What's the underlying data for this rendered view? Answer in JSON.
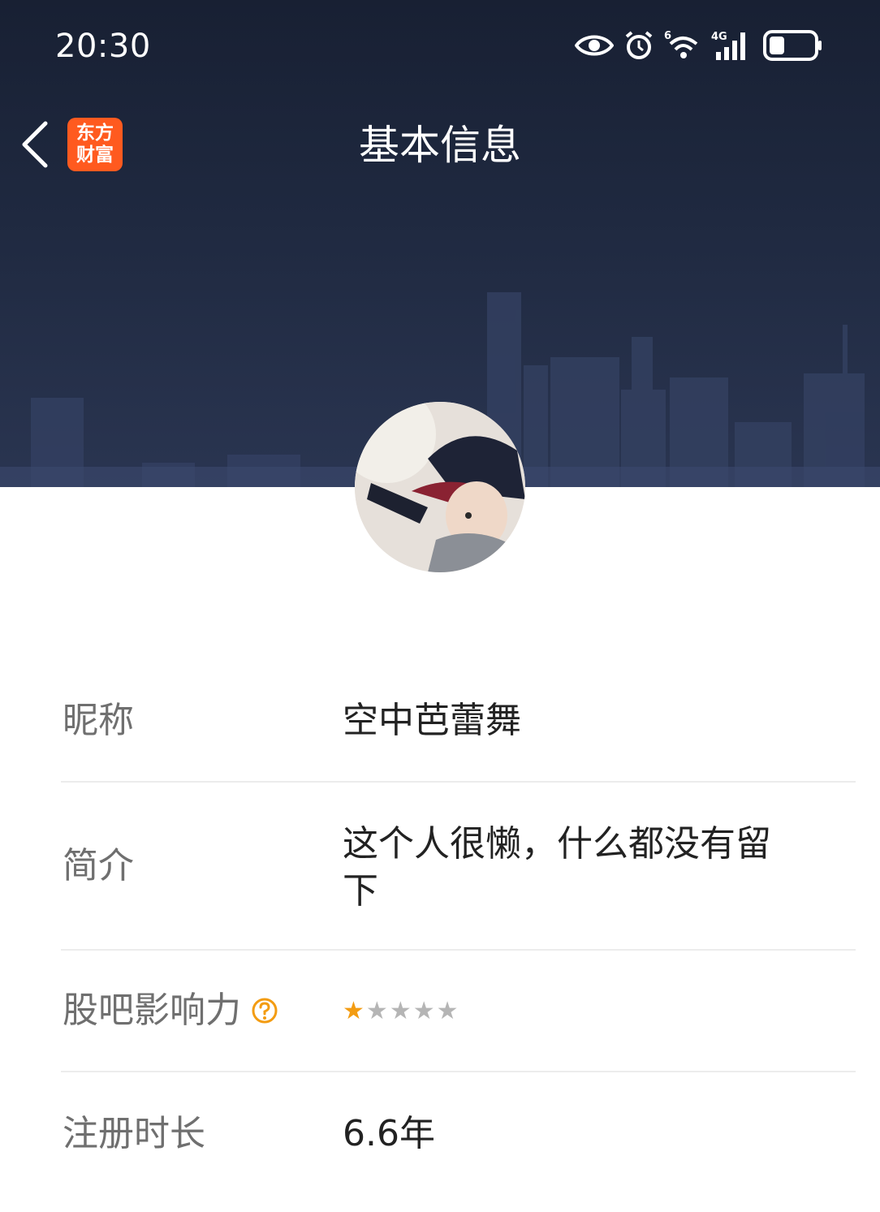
{
  "status_bar": {
    "time": "20:30",
    "icons": [
      "eye-icon",
      "alarm-icon",
      "wifi-icon",
      "cellular-signal-icon",
      "battery-icon"
    ],
    "wifi_badge": "6",
    "network_label": "4G"
  },
  "nav": {
    "back_icon": "chevron-left-icon",
    "app_logo_line1": "东方",
    "app_logo_line2": "财富",
    "title": "基本信息"
  },
  "profile": {
    "fields": [
      {
        "label": "昵称",
        "value": "空中芭蕾舞"
      },
      {
        "label": "简介",
        "value_line1": "这个人很懒，什么都没有留",
        "value_line2": "下"
      },
      {
        "label": "股吧影响力",
        "rating": 1,
        "rating_max": 5
      },
      {
        "label": "注册时长",
        "value": "6.6年"
      }
    ]
  },
  "colors": {
    "header_bg": "#1f2940",
    "logo_orange": "#ff5a1f",
    "star_active": "#f39c12",
    "star_inactive": "#b5b5b5",
    "help_orange": "#f39c12"
  }
}
